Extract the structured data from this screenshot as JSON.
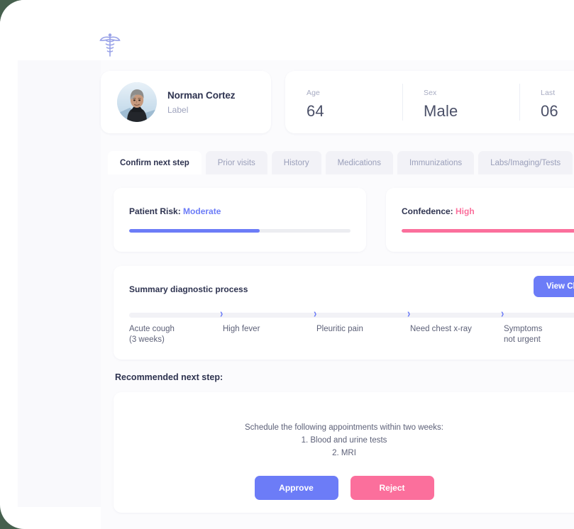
{
  "window": {
    "background_color": "#46604e",
    "surface_color": "#ffffff",
    "canvas_color": "#fbfbfd"
  },
  "branding": {
    "logo_icon": "caduceus-icon",
    "logo_color": "#9aa3e8"
  },
  "patient": {
    "name": "Norman Cortez",
    "label": "Label",
    "avatar_alt": "patient-photo"
  },
  "stats": [
    {
      "key": "Age",
      "value": "64"
    },
    {
      "key": "Sex",
      "value": "Male"
    },
    {
      "key": "Last",
      "value": "06"
    }
  ],
  "tabs": [
    {
      "label": "Confirm next step",
      "active": true
    },
    {
      "label": "Prior visits",
      "active": false
    },
    {
      "label": "History",
      "active": false
    },
    {
      "label": "Medications",
      "active": false
    },
    {
      "label": "Immunizations",
      "active": false
    },
    {
      "label": "Labs/Imaging/Tests",
      "active": false
    }
  ],
  "meters": {
    "risk": {
      "title_prefix": "Patient Risk: ",
      "value": "Moderate",
      "percent": 59,
      "color": "#6c7cf7"
    },
    "confidence": {
      "title_prefix": "Confedence: ",
      "value": "High",
      "percent": 100,
      "color": "#fb6f9c"
    }
  },
  "summary": {
    "title": "Summary diagnostic process",
    "view_chart_label": "View Chart",
    "separator_icon": "chevron-right-icon",
    "steps": [
      "Acute cough\n(3 weeks)",
      "High fever",
      "Pleuritic pain",
      "Need chest x-ray",
      "Symptoms\nnot urgent"
    ]
  },
  "recommendation": {
    "title": "Recommended next step:",
    "body": "Schedule the following appointments within two weeks:\n1. Blood and urine tests\n2. MRI",
    "approve_label": "Approve",
    "reject_label": "Reject"
  }
}
